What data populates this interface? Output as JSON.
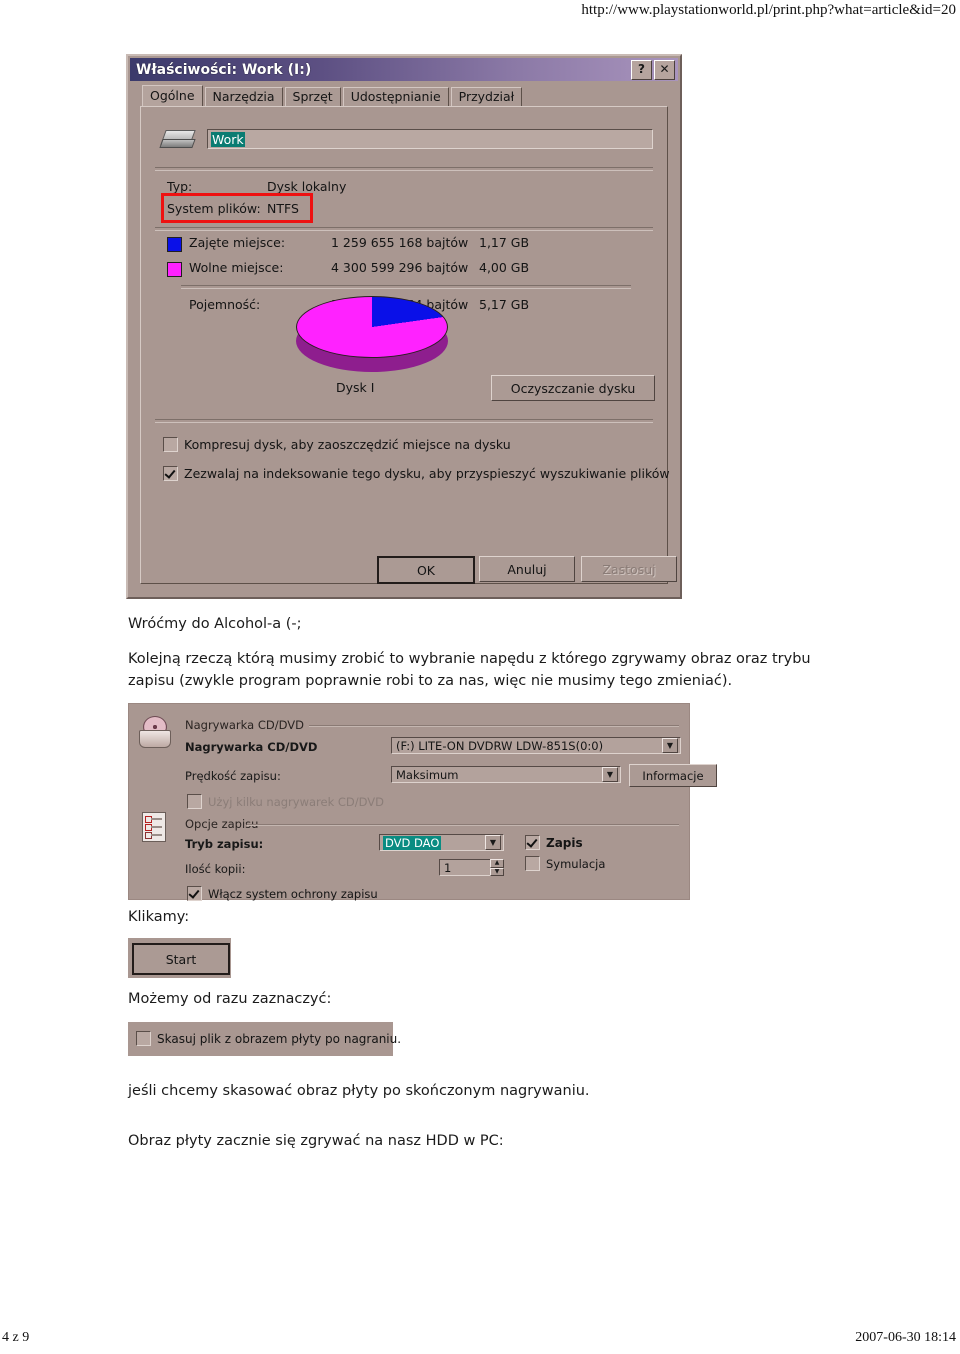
{
  "page": {
    "url": "http://www.playstationworld.pl/print.php?what=article&id=20",
    "footer_left": "4 z 9",
    "footer_right": "2007-06-30 18:14"
  },
  "properties_dialog": {
    "title": "Właściwości: Work (I:)",
    "help_button": "?",
    "close_button": "✕",
    "tabs": [
      {
        "label": "Ogólne",
        "active": true
      },
      {
        "label": "Narzędzia",
        "active": false
      },
      {
        "label": "Sprzęt",
        "active": false
      },
      {
        "label": "Udostępnianie",
        "active": false
      },
      {
        "label": "Przydział",
        "active": false
      }
    ],
    "volume_name": "Work",
    "type_label": "Typ:",
    "type_value": "Dysk lokalny",
    "filesystem_label": "System plików:",
    "filesystem_value": "NTFS",
    "used_label": "Zajęte miejsce:",
    "used_bytes": "1 259 655 168 bajtów",
    "used_gb": "1,17 GB",
    "free_label": "Wolne miejsce:",
    "free_bytes": "4 300 599 296 bajtów",
    "free_gb": "4,00 GB",
    "capacity_label": "Pojemność:",
    "capacity_bytes": "5 560 254 464 bajtów",
    "capacity_gb": "5,17 GB",
    "disk_caption": "Dysk I",
    "cleanup_button": "Oczyszczanie dysku",
    "compress_checkbox": "Kompresuj dysk, aby zaoszczędzić miejsce na dysku",
    "index_checkbox": "Zezwalaj na indeksowanie tego dysku, aby przyspieszyć wyszukiwanie plików",
    "ok_button": "OK",
    "cancel_button": "Anuluj",
    "apply_button": "Zastosuj",
    "colors": {
      "used_swatch": "#0a10e8",
      "free_swatch": "#ff22ff",
      "highlight_box": "#ee1111"
    }
  },
  "chart_data": {
    "type": "pie",
    "title": "Dysk I",
    "categories": [
      "Zajęte miejsce",
      "Wolne miejsce"
    ],
    "values": [
      1.17,
      4.0
    ],
    "units": "GB",
    "percentages": [
      22.7,
      77.3
    ],
    "colors": [
      "#0a10e8",
      "#ff22ff"
    ],
    "legend": "left",
    "grid": false
  },
  "text": {
    "line1": "Wróćmy do Alcohol-a (-;",
    "para1": "Kolejną rzeczą którą musimy zrobić to wybranie napędu z którego zgrywamy obraz oraz trybu zapisu (zwykle program poprawnie robi to za nas, więc nie musimy tego zmieniać).",
    "line_klikamy": "Klikamy:",
    "line_mozemy": "Możemy od razu zaznaczyć:",
    "line_jesli": "jeśli chcemy skasować obraz płyty po skończonym nagrywaniu.",
    "line_obraz": "Obraz płyty zacznie się zgrywać na nasz HDD w PC:"
  },
  "alcohol_panel": {
    "group_recorder": "Nagrywarka CD/DVD",
    "recorder_label": "Nagrywarka CD/DVD",
    "recorder_value": "(F:) LITE-ON DVDRW LDW-851S(0:0)",
    "speed_label": "Prędkość zapisu:",
    "speed_value": "Maksimum",
    "info_button": "Informacje",
    "multi_recorder_checkbox": "Użyj kilku nagrywarek CD/DVD",
    "group_write_options": "Opcje zapisu",
    "write_mode_label": "Tryb zapisu:",
    "write_mode_value": "DVD DAO",
    "copies_label": "Ilość kopii:",
    "copies_value": "1",
    "write_checkbox": "Zapis",
    "simulate_checkbox": "Symulacja",
    "protection_checkbox": "Włącz system ochrony zapisu"
  },
  "start_screenshot": {
    "label": "Start"
  },
  "delete_screenshot": {
    "label": "Skasuj plik z obrazem płyty po nagraniu."
  }
}
